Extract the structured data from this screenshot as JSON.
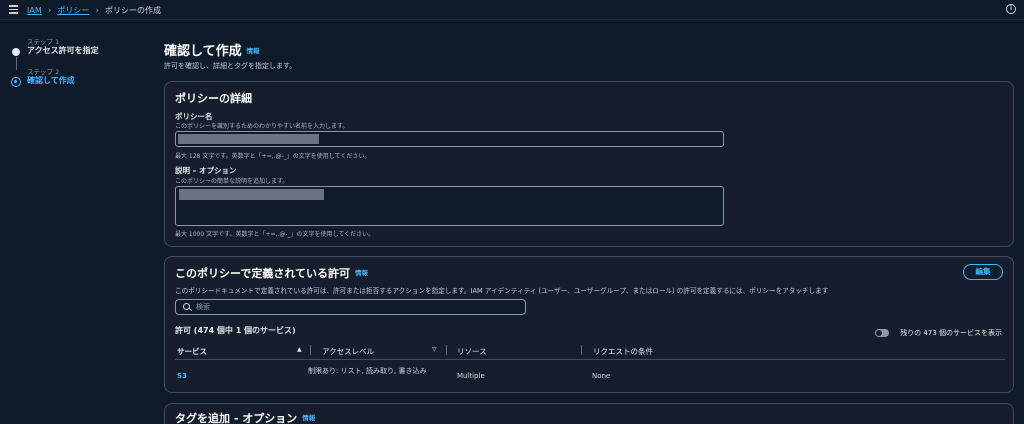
{
  "breadcrumb": {
    "root": "IAM",
    "parent": "ポリシー",
    "current": "ポリシーの作成"
  },
  "steps": [
    {
      "label": "ステップ 1",
      "title": "アクセス許可を指定"
    },
    {
      "label": "ステップ 2",
      "title": "確認して作成"
    }
  ],
  "page": {
    "title": "確認して作成",
    "info": "情報",
    "description": "許可を確認し、詳細とタグを指定します。"
  },
  "details": {
    "title": "ポリシーの詳細",
    "name_label": "ポリシー名",
    "name_desc": "このポリシーを識別するためのわかりやすい名前を入力します。",
    "name_hint": "最大 128 文字です。英数字と「+=,.@-_」の文字を使用してください。",
    "desc_label": "説明 – オプション",
    "desc_desc": "このポリシーの簡単な説明を追加します。",
    "desc_hint": "最大 1000 文字です。英数字と「+=,.@-_」の文字を使用してください。"
  },
  "permissions": {
    "title": "このポリシーで定義されている許可",
    "info": "情報",
    "edit": "編集",
    "description": "このポリシードキュメントで定義されている許可は、許可または拒否するアクションを指定します。IAM アイデンティティ (ユーザー、ユーザーグループ、またはロール) の許可を定義するには、ポリシーをアタッチします",
    "search_placeholder": "検索",
    "count_label": "許可 (474 個中 1 個のサービス)",
    "toggle_label": "残りの 473 個のサービスを表示",
    "columns": [
      "サービス",
      "アクセスレベル",
      "リソース",
      "リクエストの条件"
    ],
    "rows": [
      {
        "service": "S3",
        "access": "制限あり: リスト, 読み取り, 書き込み",
        "resource": "Multiple",
        "condition": "None"
      }
    ]
  },
  "tags": {
    "title": "タグを追加 - オプション",
    "info": "情報"
  }
}
